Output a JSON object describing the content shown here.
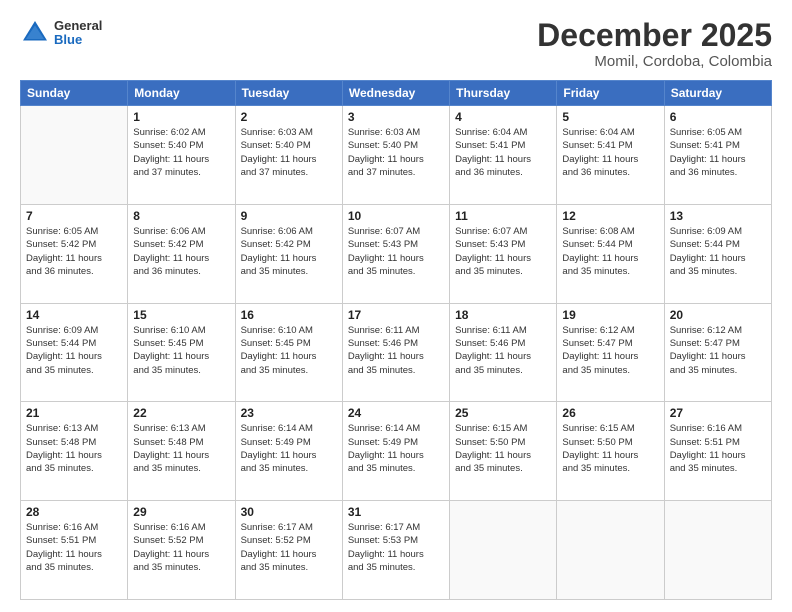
{
  "header": {
    "logo_general": "General",
    "logo_blue": "Blue",
    "main_title": "December 2025",
    "subtitle": "Momil, Cordoba, Colombia"
  },
  "calendar": {
    "days_of_week": [
      "Sunday",
      "Monday",
      "Tuesday",
      "Wednesday",
      "Thursday",
      "Friday",
      "Saturday"
    ],
    "weeks": [
      [
        {
          "day": "",
          "info": ""
        },
        {
          "day": "1",
          "info": "Sunrise: 6:02 AM\nSunset: 5:40 PM\nDaylight: 11 hours\nand 37 minutes."
        },
        {
          "day": "2",
          "info": "Sunrise: 6:03 AM\nSunset: 5:40 PM\nDaylight: 11 hours\nand 37 minutes."
        },
        {
          "day": "3",
          "info": "Sunrise: 6:03 AM\nSunset: 5:40 PM\nDaylight: 11 hours\nand 37 minutes."
        },
        {
          "day": "4",
          "info": "Sunrise: 6:04 AM\nSunset: 5:41 PM\nDaylight: 11 hours\nand 36 minutes."
        },
        {
          "day": "5",
          "info": "Sunrise: 6:04 AM\nSunset: 5:41 PM\nDaylight: 11 hours\nand 36 minutes."
        },
        {
          "day": "6",
          "info": "Sunrise: 6:05 AM\nSunset: 5:41 PM\nDaylight: 11 hours\nand 36 minutes."
        }
      ],
      [
        {
          "day": "7",
          "info": "Sunrise: 6:05 AM\nSunset: 5:42 PM\nDaylight: 11 hours\nand 36 minutes."
        },
        {
          "day": "8",
          "info": "Sunrise: 6:06 AM\nSunset: 5:42 PM\nDaylight: 11 hours\nand 36 minutes."
        },
        {
          "day": "9",
          "info": "Sunrise: 6:06 AM\nSunset: 5:42 PM\nDaylight: 11 hours\nand 35 minutes."
        },
        {
          "day": "10",
          "info": "Sunrise: 6:07 AM\nSunset: 5:43 PM\nDaylight: 11 hours\nand 35 minutes."
        },
        {
          "day": "11",
          "info": "Sunrise: 6:07 AM\nSunset: 5:43 PM\nDaylight: 11 hours\nand 35 minutes."
        },
        {
          "day": "12",
          "info": "Sunrise: 6:08 AM\nSunset: 5:44 PM\nDaylight: 11 hours\nand 35 minutes."
        },
        {
          "day": "13",
          "info": "Sunrise: 6:09 AM\nSunset: 5:44 PM\nDaylight: 11 hours\nand 35 minutes."
        }
      ],
      [
        {
          "day": "14",
          "info": "Sunrise: 6:09 AM\nSunset: 5:44 PM\nDaylight: 11 hours\nand 35 minutes."
        },
        {
          "day": "15",
          "info": "Sunrise: 6:10 AM\nSunset: 5:45 PM\nDaylight: 11 hours\nand 35 minutes."
        },
        {
          "day": "16",
          "info": "Sunrise: 6:10 AM\nSunset: 5:45 PM\nDaylight: 11 hours\nand 35 minutes."
        },
        {
          "day": "17",
          "info": "Sunrise: 6:11 AM\nSunset: 5:46 PM\nDaylight: 11 hours\nand 35 minutes."
        },
        {
          "day": "18",
          "info": "Sunrise: 6:11 AM\nSunset: 5:46 PM\nDaylight: 11 hours\nand 35 minutes."
        },
        {
          "day": "19",
          "info": "Sunrise: 6:12 AM\nSunset: 5:47 PM\nDaylight: 11 hours\nand 35 minutes."
        },
        {
          "day": "20",
          "info": "Sunrise: 6:12 AM\nSunset: 5:47 PM\nDaylight: 11 hours\nand 35 minutes."
        }
      ],
      [
        {
          "day": "21",
          "info": "Sunrise: 6:13 AM\nSunset: 5:48 PM\nDaylight: 11 hours\nand 35 minutes."
        },
        {
          "day": "22",
          "info": "Sunrise: 6:13 AM\nSunset: 5:48 PM\nDaylight: 11 hours\nand 35 minutes."
        },
        {
          "day": "23",
          "info": "Sunrise: 6:14 AM\nSunset: 5:49 PM\nDaylight: 11 hours\nand 35 minutes."
        },
        {
          "day": "24",
          "info": "Sunrise: 6:14 AM\nSunset: 5:49 PM\nDaylight: 11 hours\nand 35 minutes."
        },
        {
          "day": "25",
          "info": "Sunrise: 6:15 AM\nSunset: 5:50 PM\nDaylight: 11 hours\nand 35 minutes."
        },
        {
          "day": "26",
          "info": "Sunrise: 6:15 AM\nSunset: 5:50 PM\nDaylight: 11 hours\nand 35 minutes."
        },
        {
          "day": "27",
          "info": "Sunrise: 6:16 AM\nSunset: 5:51 PM\nDaylight: 11 hours\nand 35 minutes."
        }
      ],
      [
        {
          "day": "28",
          "info": "Sunrise: 6:16 AM\nSunset: 5:51 PM\nDaylight: 11 hours\nand 35 minutes."
        },
        {
          "day": "29",
          "info": "Sunrise: 6:16 AM\nSunset: 5:52 PM\nDaylight: 11 hours\nand 35 minutes."
        },
        {
          "day": "30",
          "info": "Sunrise: 6:17 AM\nSunset: 5:52 PM\nDaylight: 11 hours\nand 35 minutes."
        },
        {
          "day": "31",
          "info": "Sunrise: 6:17 AM\nSunset: 5:53 PM\nDaylight: 11 hours\nand 35 minutes."
        },
        {
          "day": "",
          "info": ""
        },
        {
          "day": "",
          "info": ""
        },
        {
          "day": "",
          "info": ""
        }
      ]
    ]
  }
}
